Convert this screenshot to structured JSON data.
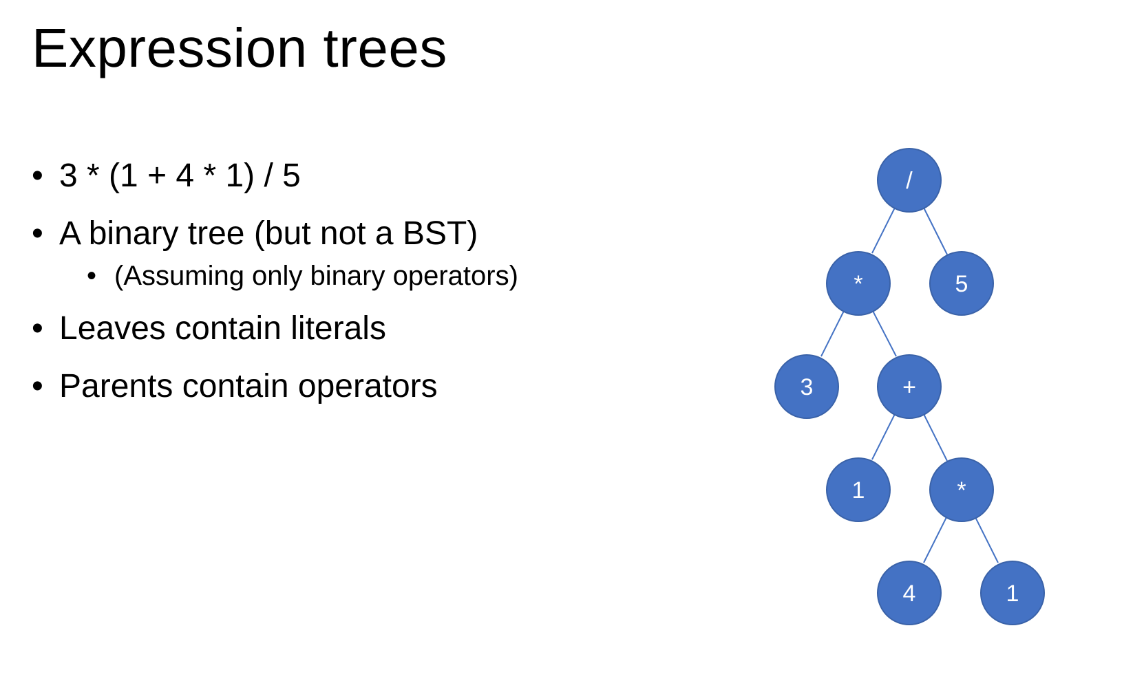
{
  "title": "Expression trees",
  "bullets": [
    {
      "text": "3 * (1 + 4 * 1) / 5",
      "level": 1
    },
    {
      "text": "A binary tree (but not a BST)",
      "level": 1
    },
    {
      "text": "(Assuming only binary operators)",
      "level": 2
    },
    {
      "text": "Leaves contain literals",
      "level": 1
    },
    {
      "text": "Parents contain operators",
      "level": 1
    }
  ],
  "tree": {
    "node_color": "#4472C4",
    "edge_color": "#4472C4",
    "label_color": "#FFFFFF",
    "nodes": {
      "root_div": "/",
      "mul_left": "*",
      "five": "5",
      "three": "3",
      "plus": "+",
      "one_left": "1",
      "mul_inner": "*",
      "four": "4",
      "one_right": "1"
    }
  }
}
